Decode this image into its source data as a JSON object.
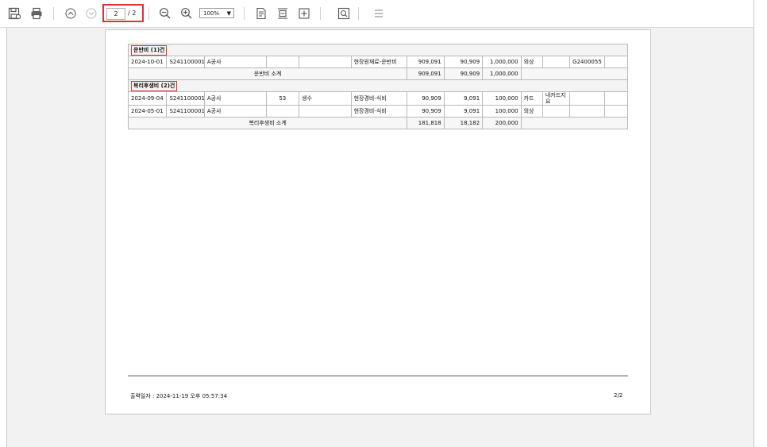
{
  "toolbar": {
    "icons": [
      "save-icon",
      "print-icon",
      "chevron-up-icon",
      "chevron-down-icon",
      "zoom-out-icon",
      "zoom-in-icon",
      "fit-page-icon",
      "fit-width-icon",
      "export-icon",
      "search-icon",
      "menu-icon"
    ],
    "page_current": "2",
    "page_total": "/ 2",
    "zoom": "100%"
  },
  "report": {
    "sections": [
      {
        "title": "운반비 (1)건",
        "rows": [
          {
            "date": "2024-10-01",
            "code": "S241100001",
            "vendor": "A공사",
            "qty": "",
            "item": "",
            "account": "현장원재료-운반비",
            "supply": "909,091",
            "vat": "90,909",
            "total": "1,000,000",
            "type": "외상",
            "note": "",
            "doc": "G2400055"
          }
        ],
        "subtotal": {
          "label": "운반비 소계",
          "supply": "909,091",
          "vat": "90,909",
          "total": "1,000,000"
        }
      },
      {
        "title": "복리후생비 (2)건",
        "rows": [
          {
            "date": "2024-09-04",
            "code": "S241100001",
            "vendor": "A공사",
            "qty": "53",
            "item": "생수",
            "account": "현장경비-식비",
            "supply": "90,909",
            "vat": "9,091",
            "total": "100,000",
            "type": "카드",
            "note": "내카드지요",
            "doc": ""
          },
          {
            "date": "2024-05-01",
            "code": "S241100001",
            "vendor": "A공사",
            "qty": "",
            "item": "",
            "account": "현장경비-식비",
            "supply": "90,909",
            "vat": "9,091",
            "total": "100,000",
            "type": "외상",
            "note": "",
            "doc": ""
          }
        ],
        "subtotal": {
          "label": "복리후생비 소계",
          "supply": "181,818",
          "vat": "18,182",
          "total": "200,000"
        }
      }
    ],
    "footer": {
      "printed": "출력일자 : 2024-11-19  오후 05:57:34",
      "page": "2/2"
    }
  }
}
